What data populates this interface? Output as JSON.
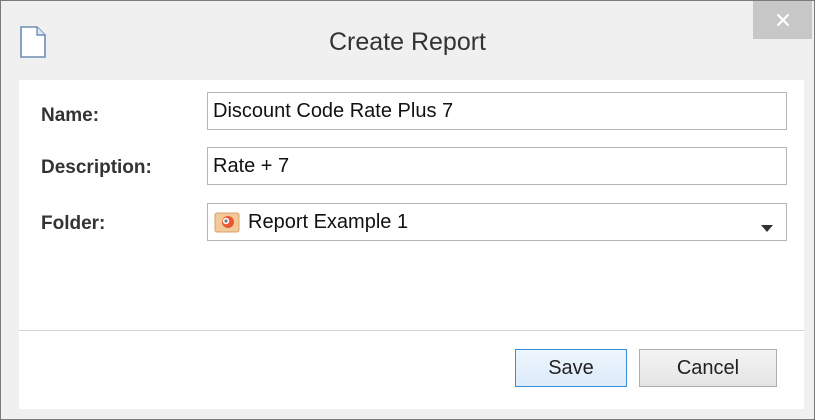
{
  "window": {
    "title": "Create Report",
    "icon": "document-icon",
    "close_icon": "close-icon"
  },
  "form": {
    "name_label": "Name:",
    "name_value": "Discount Code Rate Plus 7",
    "description_label": "Description:",
    "description_value": "Rate + 7",
    "folder_label": "Folder:",
    "folder_value": "Report Example 1",
    "folder_icon": "report-folder-icon"
  },
  "buttons": {
    "save_label": "Save",
    "cancel_label": "Cancel"
  },
  "colors": {
    "titlebar": "#f0f0f0",
    "close_button": "#c7c7c7",
    "save_border": "#3c8fd9"
  }
}
